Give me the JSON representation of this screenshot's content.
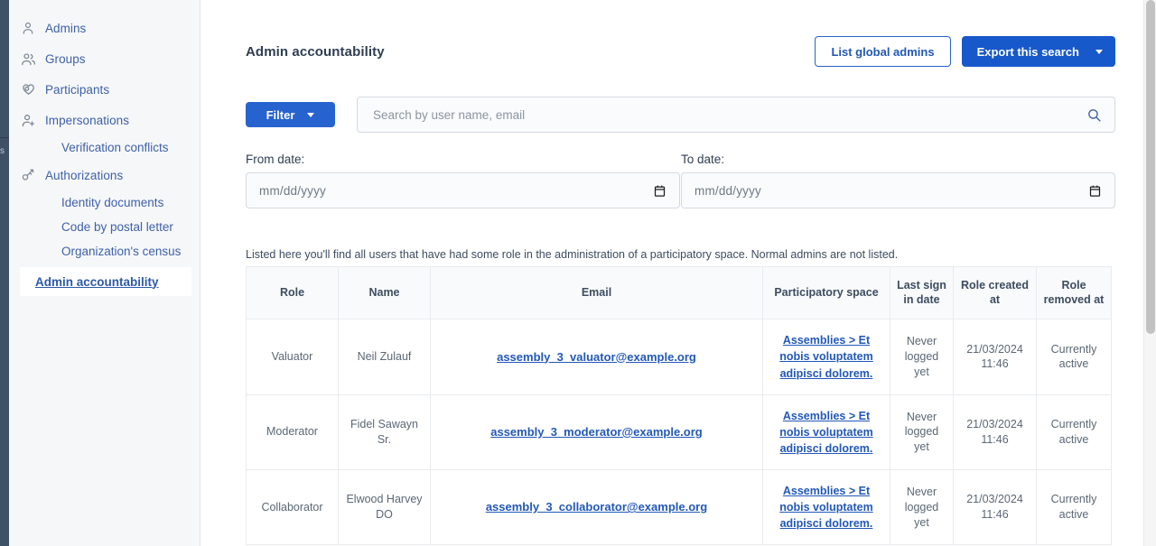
{
  "sidebar": {
    "items": [
      {
        "label": "Admins",
        "icon": "user-icon",
        "type": "top"
      },
      {
        "label": "Groups",
        "icon": "users-icon",
        "type": "top"
      },
      {
        "label": "Participants",
        "icon": "handshake-heart-icon",
        "type": "top"
      },
      {
        "label": "Impersonations",
        "icon": "user-plus-icon",
        "type": "top"
      },
      {
        "label": "Verification conflicts",
        "icon": "",
        "type": "sub"
      },
      {
        "label": "Authorizations",
        "icon": "key-icon",
        "type": "top"
      },
      {
        "label": "Identity documents",
        "icon": "",
        "type": "sub"
      },
      {
        "label": "Code by postal letter",
        "icon": "",
        "type": "sub"
      },
      {
        "label": "Organization's census",
        "icon": "",
        "type": "sub"
      }
    ],
    "active_item": "Admin accountability",
    "rail_glyph": "s"
  },
  "header": {
    "title": "Admin accountability",
    "list_global_admins_label": "List global admins",
    "export_label": "Export this search"
  },
  "search": {
    "filter_label": "Filter",
    "placeholder": "Search by user name, email",
    "value": ""
  },
  "dates": {
    "from_label": "From date:",
    "from_placeholder": "mm/dd/yyyy",
    "to_label": "To date:",
    "to_placeholder": "mm/dd/yyyy"
  },
  "table": {
    "note": "Listed here you'll find all users that have had some role in the administration of a participatory space. Normal admins are not listed.",
    "columns": [
      "Role",
      "Name",
      "Email",
      "Participatory space",
      "Last sign in date",
      "Role created at",
      "Role removed at"
    ],
    "rows": [
      {
        "role": "Valuator",
        "name": "Neil Zulauf",
        "email": "assembly_3_valuator@example.org",
        "space": "Assemblies > Et nobis voluptatem adipisci dolorem.",
        "last_sign_in": "Never logged yet",
        "role_created_at": "21/03/2024 11:46",
        "role_removed_at": "Currently active"
      },
      {
        "role": "Moderator",
        "name": "Fidel Sawayn Sr.",
        "email": "assembly_3_moderator@example.org",
        "space": "Assemblies > Et nobis voluptatem adipisci dolorem.",
        "last_sign_in": "Never logged yet",
        "role_created_at": "21/03/2024 11:46",
        "role_removed_at": "Currently active"
      },
      {
        "role": "Collaborator",
        "name": "Elwood Harvey DO",
        "email": "assembly_3_collaborator@example.org",
        "space": "Assemblies > Et nobis voluptatem adipisci dolorem.",
        "last_sign_in": "Never logged yet",
        "role_created_at": "21/03/2024 11:46",
        "role_removed_at": "Currently active"
      }
    ]
  },
  "colors": {
    "primary_blue": "#1758ca",
    "filter_blue": "#2763cf",
    "link_blue": "#2258b8",
    "nav_blue": "#3e61a8",
    "status_green": "#4a9d5f",
    "rail_navy": "#3f5166"
  }
}
